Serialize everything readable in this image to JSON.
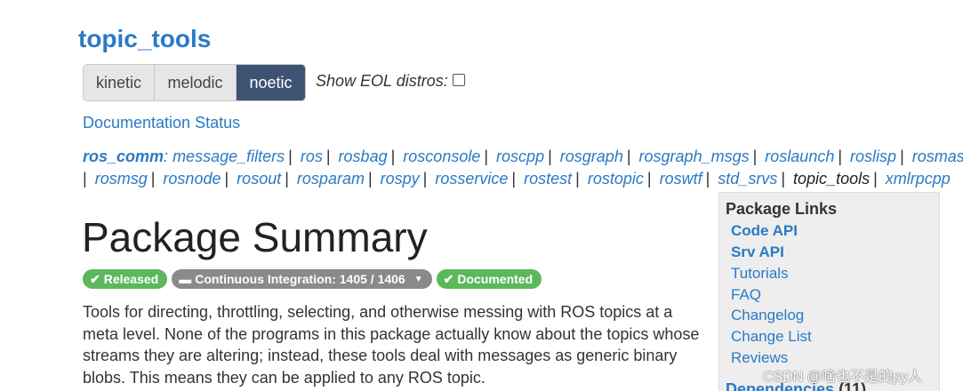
{
  "package_title": "topic_tools",
  "distros": {
    "buttons": [
      {
        "label": "kinetic",
        "active": false
      },
      {
        "label": "melodic",
        "active": false
      },
      {
        "label": "noetic",
        "active": true
      }
    ],
    "eol_label": "Show EOL distros:",
    "eol_checked": false
  },
  "documentation_status": "Documentation Status",
  "stack": {
    "name": "ros_comm",
    "line1": [
      "message_filters",
      "ros",
      "rosbag",
      "rosconsole",
      "roscpp",
      "rosgraph",
      "rosgraph_msgs",
      "roslaunch",
      "roslisp",
      "rosmaster"
    ],
    "line2": [
      "rosmsg",
      "rosnode",
      "rosout",
      "rosparam",
      "rospy",
      "rosservice",
      "rostest",
      "rostopic",
      "roswtf",
      "std_srvs",
      "topic_tools",
      "xmlrpcpp"
    ],
    "current": "topic_tools"
  },
  "summary_title": "Package Summary",
  "badges": [
    {
      "icon": "check-icon",
      "glyph": "✔",
      "label": "Released",
      "color": "#5cb85c"
    },
    {
      "icon": "minus-icon",
      "glyph": "▬",
      "label": "Continuous Integration: 1405 / 1406",
      "color": "#8a8a8a",
      "dropdown": true
    },
    {
      "icon": "check-icon",
      "glyph": "✔",
      "label": "Documented",
      "color": "#5cb85c"
    }
  ],
  "description": "Tools for directing, throttling, selecting, and otherwise messing with ROS topics at a meta level. None of the programs in this package actually know about the topics whose streams they are altering; instead, these tools deal with messages as generic binary blobs. This means they can be applied to any ROS topic.",
  "sidebar": {
    "title": "Package Links",
    "links": [
      {
        "label": "Code API",
        "bold": true
      },
      {
        "label": "Srv API",
        "bold": true
      },
      {
        "label": "Tutorials",
        "bold": false
      },
      {
        "label": "FAQ",
        "bold": false
      },
      {
        "label": "Changelog",
        "bold": false
      },
      {
        "label": "Change List",
        "bold": false
      },
      {
        "label": "Reviews",
        "bold": false
      }
    ],
    "dependencies_label": "Dependencies",
    "dependencies_count": "(11)"
  },
  "watermark": "CSDN @啥也不是的py人",
  "colors": {
    "link": "#2a7ac4",
    "active_distro": "#3e5373",
    "badge_green": "#5cb85c",
    "badge_grey": "#8a8a8a"
  }
}
